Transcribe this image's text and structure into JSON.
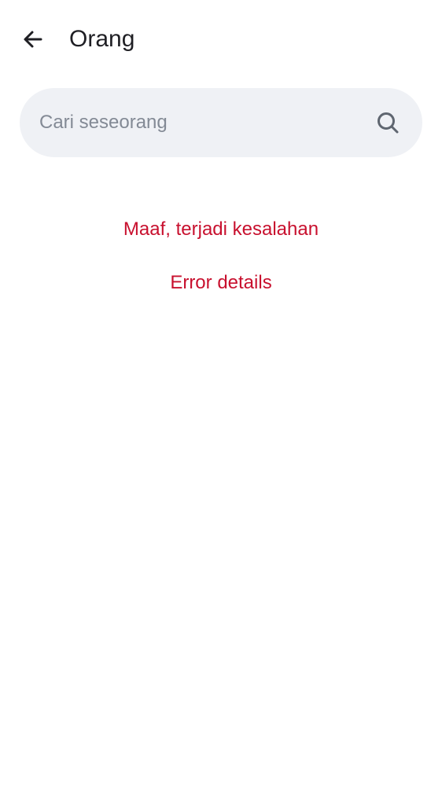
{
  "header": {
    "title": "Orang",
    "back_icon": "arrow-left-icon"
  },
  "search": {
    "placeholder": "Cari seseorang",
    "value": "",
    "icon": "search-icon"
  },
  "error": {
    "message": "Maaf, terjadi kesalahan",
    "details_label": "Error details",
    "color": "#c8102e"
  },
  "colors": {
    "background": "#ffffff",
    "search_background": "#eff1f5",
    "title": "#1f1f24",
    "placeholder": "#838a95"
  }
}
